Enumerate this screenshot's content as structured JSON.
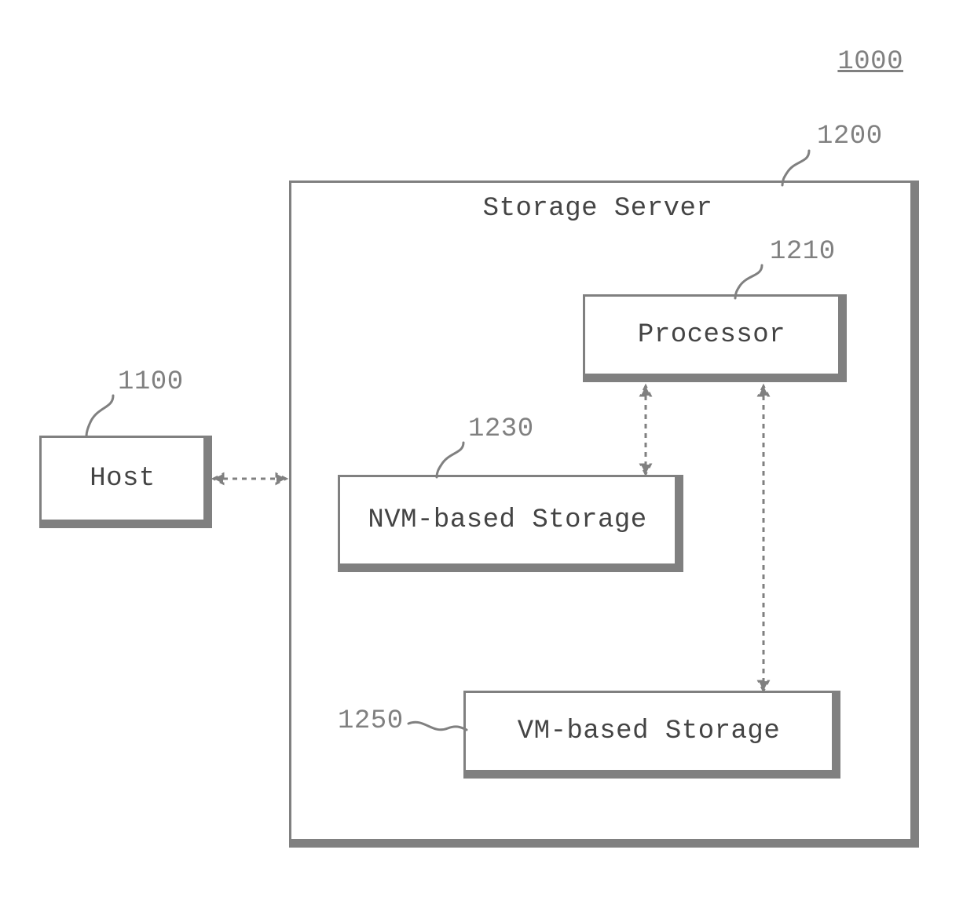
{
  "figure": {
    "system_ref": "1000"
  },
  "server": {
    "ref": "1200",
    "title": "Storage Server"
  },
  "host": {
    "ref": "1100",
    "label": "Host"
  },
  "processor": {
    "ref": "1210",
    "label": "Processor"
  },
  "nvm": {
    "ref": "1230",
    "label": "NVM-based Storage"
  },
  "vm": {
    "ref": "1250",
    "label": "VM-based Storage"
  }
}
